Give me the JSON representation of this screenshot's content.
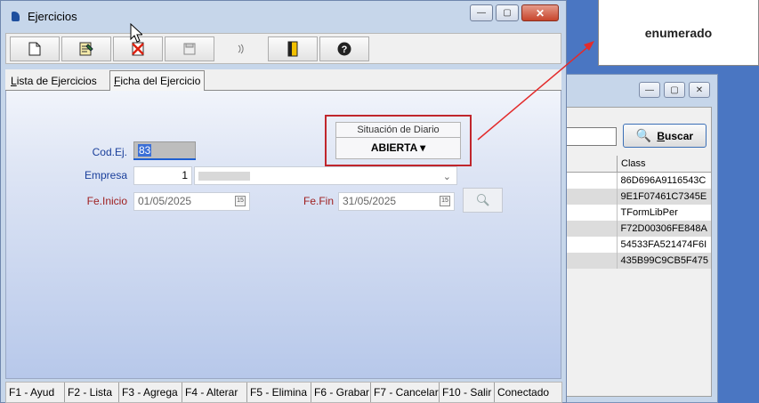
{
  "tooltip": {
    "text": "enumerado"
  },
  "background_window": {
    "search_button_label": "Buscar",
    "table": {
      "column_header": "Class",
      "rows": [
        "86D696A9116543C",
        "9E1F07461C7345E",
        "TFormLibPer",
        "F72D00306FE848A",
        "54533FA521474F6I",
        "435B99C9CB5F475"
      ]
    }
  },
  "window": {
    "title": "Ejercicios",
    "controls": {
      "minimize": "—",
      "maximize": "▢",
      "close": "✕"
    }
  },
  "toolbar": {
    "buttons": [
      {
        "name": "new",
        "icon": "new-document-icon"
      },
      {
        "name": "edit",
        "icon": "edit-document-icon"
      },
      {
        "name": "delete",
        "icon": "delete-icon"
      },
      {
        "name": "save",
        "icon": "save-disk-icon"
      },
      {
        "name": "cancel",
        "icon": "cancel-icon"
      },
      {
        "name": "exit",
        "icon": "exit-door-icon"
      },
      {
        "name": "help",
        "icon": "help-icon"
      }
    ]
  },
  "tabs": [
    {
      "label_underline": "L",
      "label_rest": "ista de Ejercicios"
    },
    {
      "label_underline": "F",
      "label_rest": "icha del Ejercicio"
    }
  ],
  "form": {
    "codej_label": "Cod.Ej.",
    "codej_value": "83",
    "empresa_label": "Empresa",
    "empresa_value": "1",
    "feinicio_label": "Fe.Inicio",
    "feinicio_value": "01/05/2025",
    "fefin_label": "Fe.Fin",
    "fefin_value": "31/05/2025",
    "situacion_title": "Situación de Diario",
    "situacion_value": "ABIERTA ▾"
  },
  "statusbar": {
    "items": [
      "F1 - Ayud",
      "F2 - Lista",
      "F3 - Agrega",
      "F4 - Alterar",
      "F5 - Elimina",
      "F6 - Grabar",
      "F7 - Cancelar",
      "F10 - Salir",
      "Conectado"
    ]
  },
  "colors": {
    "desktop": "#4a76c2",
    "highlight_red": "#c0262c",
    "label_blue": "#1a3f9b",
    "label_red": "#9e1c1c"
  }
}
